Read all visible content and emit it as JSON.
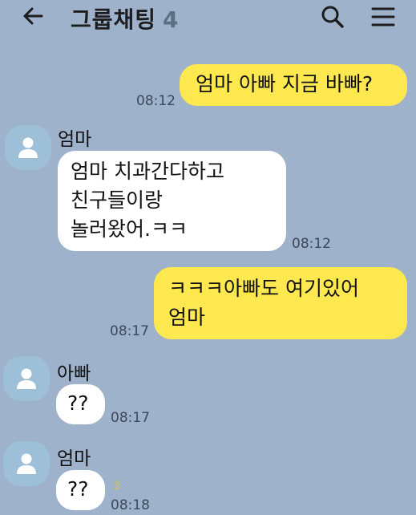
{
  "header": {
    "title": "그룹채팅",
    "member_count": "4"
  },
  "messages": [
    {
      "text": "엄마 아빠 지금 바빠?",
      "time": "08:12"
    },
    {
      "sender": "엄마",
      "lines": [
        "엄마 치과간다하고",
        "친구들이랑",
        "놀러왔어.ㅋㅋ"
      ],
      "time": "08:12"
    },
    {
      "lines": [
        "ㅋㅋㅋ아빠도 여기있어",
        "엄마"
      ],
      "time": "08:17"
    },
    {
      "sender": "아빠",
      "text": "??",
      "time": "08:17"
    },
    {
      "sender": "엄마",
      "text": "??",
      "time": "08:18",
      "unread": "3"
    }
  ],
  "colors": {
    "background": "#9eb2cb",
    "my_bubble": "#fde94f",
    "their_bubble": "#ffffff",
    "avatar": "#9dc0d8"
  }
}
